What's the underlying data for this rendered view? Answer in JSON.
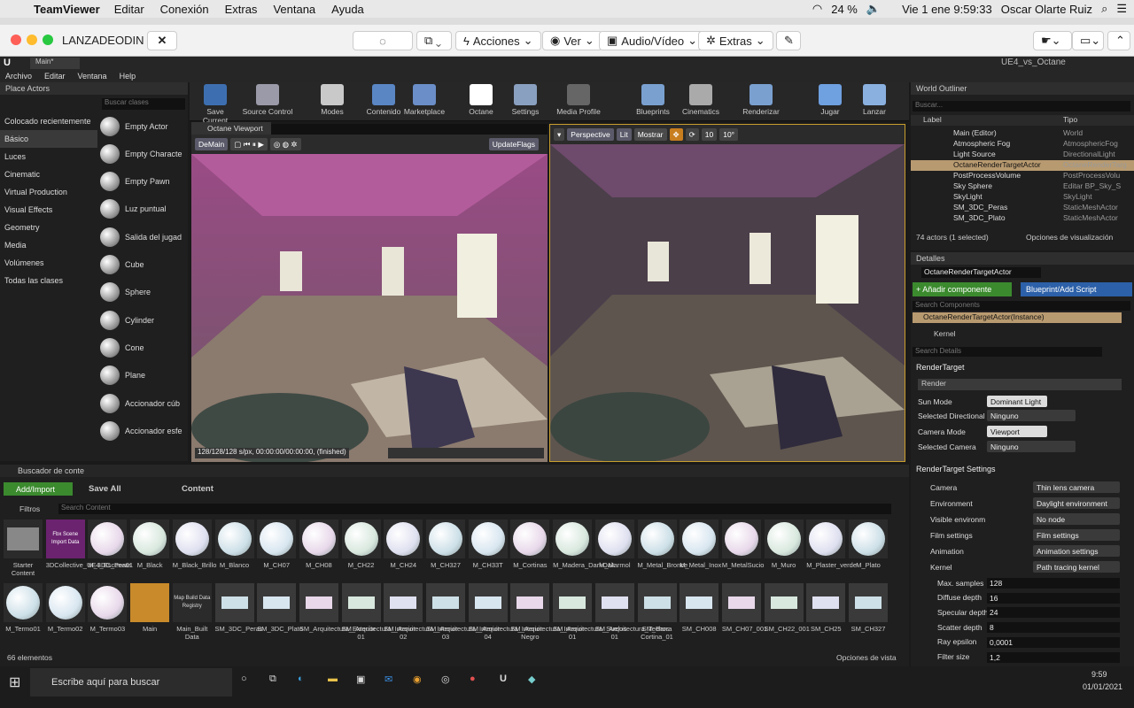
{
  "mac": {
    "app": "TeamViewer",
    "menus": [
      "Editar",
      "Conexión",
      "Extras",
      "Ventana",
      "Ayuda"
    ],
    "battery": "24 %",
    "datetime": "Vie 1 ene  9:59:33",
    "user": "Oscar Olarte Ruiz"
  },
  "tv": {
    "title": "LANZADEODIN",
    "acciones": "Acciones",
    "ver": "Ver",
    "audio": "Audio/Vídeo",
    "extras": "Extras"
  },
  "ue": {
    "tab": "Main*",
    "project": "UE4_vs_Octane",
    "menus": [
      "Archivo",
      "Editar",
      "Ventana",
      "Help"
    ]
  },
  "place": {
    "title": "Place Actors",
    "search": "Buscar clases",
    "categories": [
      "Colocado recientemente",
      "Básico",
      "Luces",
      "Cinematic",
      "Virtual Production",
      "Visual Effects",
      "Geometry",
      "Media",
      "Volúmenes",
      "Todas las clases"
    ],
    "actors": [
      "Empty Actor",
      "Empty Characte",
      "Empty Pawn",
      "Luz puntual",
      "Salida del jugad",
      "Cube",
      "Sphere",
      "Cylinder",
      "Cone",
      "Plane",
      "Accionador cúb",
      "Accionador esfe"
    ]
  },
  "toolbar": [
    "Save Current",
    "Source Control",
    "Modes",
    "Contenido",
    "Marketplace",
    "Octane",
    "Settings",
    "Media Profile",
    "Blueprints",
    "Cinematics",
    "Renderizar",
    "Jugar",
    "Lanzar"
  ],
  "vp1": {
    "tab": "Octane Viewport",
    "main": "DeMain",
    "update": "UpdateFlags",
    "status": "128/128/128 s/px, 00:00:00/00:00:00, (finished)"
  },
  "vp2": {
    "perspective": "Perspective",
    "lit": "Lit",
    "mostrar": "Mostrar",
    "grid": "10",
    "angle": "10°"
  },
  "outliner": {
    "title": "World Outliner",
    "search": "Buscar...",
    "col_label": "Label",
    "col_type": "Tipo",
    "rows": [
      {
        "l": "Main (Editor)",
        "t": "World"
      },
      {
        "l": "Atmospheric Fog",
        "t": "AtmosphericFog"
      },
      {
        "l": "Light Source",
        "t": "DirectionalLight"
      },
      {
        "l": "OctaneRenderTargetActor",
        "t": "OctaneRenderTarg"
      },
      {
        "l": "PostProcessVolume",
        "t": "PostProcessVolu"
      },
      {
        "l": "Sky Sphere",
        "t": "Editar BP_Sky_S"
      },
      {
        "l": "SkyLight",
        "t": "SkyLight"
      },
      {
        "l": "SM_3DC_Peras",
        "t": "StaticMeshActor"
      },
      {
        "l": "SM_3DC_Plato",
        "t": "StaticMeshActor"
      }
    ],
    "count": "74 actors (1 selected)",
    "options": "Opciones de visualización"
  },
  "details": {
    "title": "Detalles",
    "actor": "OctaneRenderTargetActor",
    "add": "+ Añadir componente",
    "bp": "Blueprint/Add Script",
    "searchc": "Search Components",
    "instance": "OctaneRenderTargetActor(Instance)",
    "kernel": "Kernel",
    "searchd": "Search Details",
    "rt": "RenderTarget",
    "render": "Render",
    "sunmode_l": "Sun Mode",
    "sunmode": "Dominant Light",
    "dirl_l": "Selected Directional L",
    "dirl": "Ninguno",
    "cammode_l": "Camera Mode",
    "cammode": "Viewport",
    "selcam_l": "Selected Camera",
    "selcam": "Ninguno",
    "rts": "RenderTarget Settings",
    "props": [
      {
        "l": "Camera",
        "v": "Thin lens camera"
      },
      {
        "l": "Environment",
        "v": "Daylight environment"
      },
      {
        "l": "Visible environm",
        "v": "No node"
      },
      {
        "l": "Film settings",
        "v": "Film settings"
      },
      {
        "l": "Animation",
        "v": "Animation settings"
      },
      {
        "l": "Kernel",
        "v": "Path tracing kernel"
      }
    ],
    "nums": [
      {
        "l": "Max. samples",
        "v": "128"
      },
      {
        "l": "Diffuse depth",
        "v": "16"
      },
      {
        "l": "Specular depth",
        "v": "24"
      },
      {
        "l": "Scatter depth",
        "v": "8"
      },
      {
        "l": "Ray epsilon",
        "v": "0,0001"
      },
      {
        "l": "Filter size",
        "v": "1,2"
      }
    ]
  },
  "content": {
    "title": "Buscador de conte",
    "add": "Add/Import",
    "save": "Save All",
    "path": "Content",
    "filters": "Filtros",
    "search": "Search Content",
    "count": "66 elementos",
    "viewopts": "Opciones de vista",
    "row1": [
      "Starter Content",
      "3DCollective_UE4_Escena01",
      "M_3DC_Peras",
      "M_Black",
      "M_Black_Brillo",
      "M_Blanco",
      "M_CH07",
      "M_CH08",
      "M_CH22",
      "M_CH24",
      "M_CH327",
      "M_CH33T",
      "M_Cortinas",
      "M_Madera_DarkOak",
      "M_Marmol",
      "M_Metal_Bronce",
      "M_Metal_Inox",
      "M_MetalSucio",
      "M_Muro",
      "M_Plaster_verde",
      "M_Plato"
    ],
    "row2": [
      "M_Termo01",
      "M_Termo02",
      "M_Termo03",
      "Main",
      "Main_Built Data",
      "SM_3DC_Peras",
      "SM_3DC_Plato",
      "SM_Arquitectura_Exterior",
      "SM_Arquitectura_Interior 01",
      "SM_Arquitectura_Interior 02",
      "SM_Arquitectura_Interior 03",
      "SM_Arquitectura_Interior 04",
      "SM_Arquitectura_Interior Negro",
      "SM_Arquitectura_Suelos 01",
      "SM_Arquitectura_Techos 01",
      "SM_Barra Cortina_01",
      "SM_CH008",
      "SM_CH07_001",
      "SM_CH22_001",
      "SM_CH25",
      "SM_CH327"
    ],
    "fbx": "Fbx Scene Import Data",
    "mapbuild": "Map Build Data Registry"
  },
  "taskbar": {
    "search": "Escribe aquí para buscar",
    "time": "9:59",
    "date": "01/01/2021"
  }
}
